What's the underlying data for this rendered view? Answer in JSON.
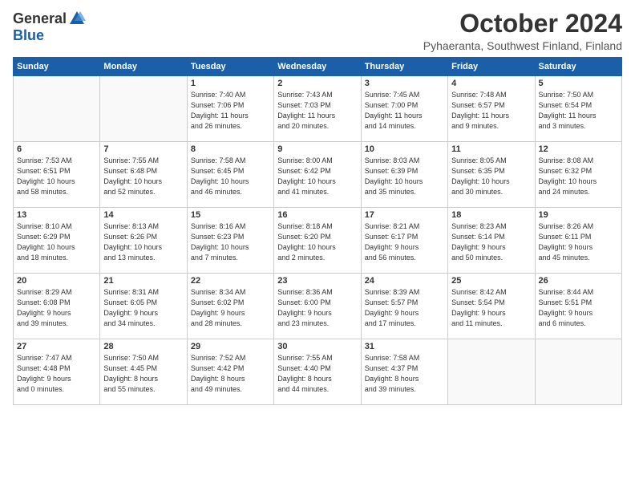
{
  "header": {
    "logo_general": "General",
    "logo_blue": "Blue",
    "month_title": "October 2024",
    "location": "Pyhaeranta, Southwest Finland, Finland"
  },
  "columns": [
    "Sunday",
    "Monday",
    "Tuesday",
    "Wednesday",
    "Thursday",
    "Friday",
    "Saturday"
  ],
  "weeks": [
    [
      {
        "day": "",
        "info": ""
      },
      {
        "day": "",
        "info": ""
      },
      {
        "day": "1",
        "info": "Sunrise: 7:40 AM\nSunset: 7:06 PM\nDaylight: 11 hours\nand 26 minutes."
      },
      {
        "day": "2",
        "info": "Sunrise: 7:43 AM\nSunset: 7:03 PM\nDaylight: 11 hours\nand 20 minutes."
      },
      {
        "day": "3",
        "info": "Sunrise: 7:45 AM\nSunset: 7:00 PM\nDaylight: 11 hours\nand 14 minutes."
      },
      {
        "day": "4",
        "info": "Sunrise: 7:48 AM\nSunset: 6:57 PM\nDaylight: 11 hours\nand 9 minutes."
      },
      {
        "day": "5",
        "info": "Sunrise: 7:50 AM\nSunset: 6:54 PM\nDaylight: 11 hours\nand 3 minutes."
      }
    ],
    [
      {
        "day": "6",
        "info": "Sunrise: 7:53 AM\nSunset: 6:51 PM\nDaylight: 10 hours\nand 58 minutes."
      },
      {
        "day": "7",
        "info": "Sunrise: 7:55 AM\nSunset: 6:48 PM\nDaylight: 10 hours\nand 52 minutes."
      },
      {
        "day": "8",
        "info": "Sunrise: 7:58 AM\nSunset: 6:45 PM\nDaylight: 10 hours\nand 46 minutes."
      },
      {
        "day": "9",
        "info": "Sunrise: 8:00 AM\nSunset: 6:42 PM\nDaylight: 10 hours\nand 41 minutes."
      },
      {
        "day": "10",
        "info": "Sunrise: 8:03 AM\nSunset: 6:39 PM\nDaylight: 10 hours\nand 35 minutes."
      },
      {
        "day": "11",
        "info": "Sunrise: 8:05 AM\nSunset: 6:35 PM\nDaylight: 10 hours\nand 30 minutes."
      },
      {
        "day": "12",
        "info": "Sunrise: 8:08 AM\nSunset: 6:32 PM\nDaylight: 10 hours\nand 24 minutes."
      }
    ],
    [
      {
        "day": "13",
        "info": "Sunrise: 8:10 AM\nSunset: 6:29 PM\nDaylight: 10 hours\nand 18 minutes."
      },
      {
        "day": "14",
        "info": "Sunrise: 8:13 AM\nSunset: 6:26 PM\nDaylight: 10 hours\nand 13 minutes."
      },
      {
        "day": "15",
        "info": "Sunrise: 8:16 AM\nSunset: 6:23 PM\nDaylight: 10 hours\nand 7 minutes."
      },
      {
        "day": "16",
        "info": "Sunrise: 8:18 AM\nSunset: 6:20 PM\nDaylight: 10 hours\nand 2 minutes."
      },
      {
        "day": "17",
        "info": "Sunrise: 8:21 AM\nSunset: 6:17 PM\nDaylight: 9 hours\nand 56 minutes."
      },
      {
        "day": "18",
        "info": "Sunrise: 8:23 AM\nSunset: 6:14 PM\nDaylight: 9 hours\nand 50 minutes."
      },
      {
        "day": "19",
        "info": "Sunrise: 8:26 AM\nSunset: 6:11 PM\nDaylight: 9 hours\nand 45 minutes."
      }
    ],
    [
      {
        "day": "20",
        "info": "Sunrise: 8:29 AM\nSunset: 6:08 PM\nDaylight: 9 hours\nand 39 minutes."
      },
      {
        "day": "21",
        "info": "Sunrise: 8:31 AM\nSunset: 6:05 PM\nDaylight: 9 hours\nand 34 minutes."
      },
      {
        "day": "22",
        "info": "Sunrise: 8:34 AM\nSunset: 6:02 PM\nDaylight: 9 hours\nand 28 minutes."
      },
      {
        "day": "23",
        "info": "Sunrise: 8:36 AM\nSunset: 6:00 PM\nDaylight: 9 hours\nand 23 minutes."
      },
      {
        "day": "24",
        "info": "Sunrise: 8:39 AM\nSunset: 5:57 PM\nDaylight: 9 hours\nand 17 minutes."
      },
      {
        "day": "25",
        "info": "Sunrise: 8:42 AM\nSunset: 5:54 PM\nDaylight: 9 hours\nand 11 minutes."
      },
      {
        "day": "26",
        "info": "Sunrise: 8:44 AM\nSunset: 5:51 PM\nDaylight: 9 hours\nand 6 minutes."
      }
    ],
    [
      {
        "day": "27",
        "info": "Sunrise: 7:47 AM\nSunset: 4:48 PM\nDaylight: 9 hours\nand 0 minutes."
      },
      {
        "day": "28",
        "info": "Sunrise: 7:50 AM\nSunset: 4:45 PM\nDaylight: 8 hours\nand 55 minutes."
      },
      {
        "day": "29",
        "info": "Sunrise: 7:52 AM\nSunset: 4:42 PM\nDaylight: 8 hours\nand 49 minutes."
      },
      {
        "day": "30",
        "info": "Sunrise: 7:55 AM\nSunset: 4:40 PM\nDaylight: 8 hours\nand 44 minutes."
      },
      {
        "day": "31",
        "info": "Sunrise: 7:58 AM\nSunset: 4:37 PM\nDaylight: 8 hours\nand 39 minutes."
      },
      {
        "day": "",
        "info": ""
      },
      {
        "day": "",
        "info": ""
      }
    ]
  ]
}
